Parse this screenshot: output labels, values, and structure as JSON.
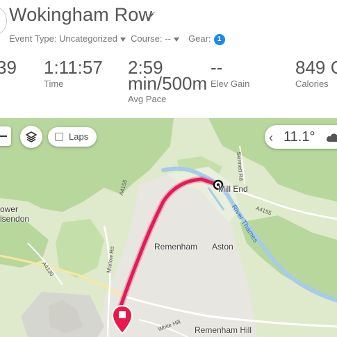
{
  "activity": {
    "title": "Wokingham Row"
  },
  "meta": {
    "event_type": "Event Type: Uncategorized",
    "course": "Course: --",
    "gear": "Gear:",
    "gear_count": "1"
  },
  "stats": [
    {
      "value": "39",
      "label": ""
    },
    {
      "value": "1:11:57",
      "label": "Time"
    },
    {
      "value": "2:59",
      "value2": "min/500m",
      "label": "Avg Pace"
    },
    {
      "value": "--",
      "label": "Elev Gain"
    },
    {
      "value": "849 C",
      "label": "Calories"
    }
  ],
  "map": {
    "laps_label": "Laps",
    "temperature": "11.1°",
    "places": {
      "mill_end": "Mill End",
      "remenham": "Remenham",
      "aston": "Aston",
      "remenham_hill": "Remenham Hill",
      "hower": "ower",
      "isendon": "isendon"
    },
    "roads": {
      "a4155_left": "A4155",
      "a4155_right": "A4155",
      "a4130": "A4130",
      "marlow_rd": "Marlow Rd",
      "skirmett_rd": "Skirmett Rd",
      "white_hill": "White Hill"
    },
    "river": "River Thames",
    "colors": {
      "route": "#e8195a",
      "woods": "#a9d08e",
      "open": "#dde8c8",
      "river": "#a7cbe8"
    }
  }
}
